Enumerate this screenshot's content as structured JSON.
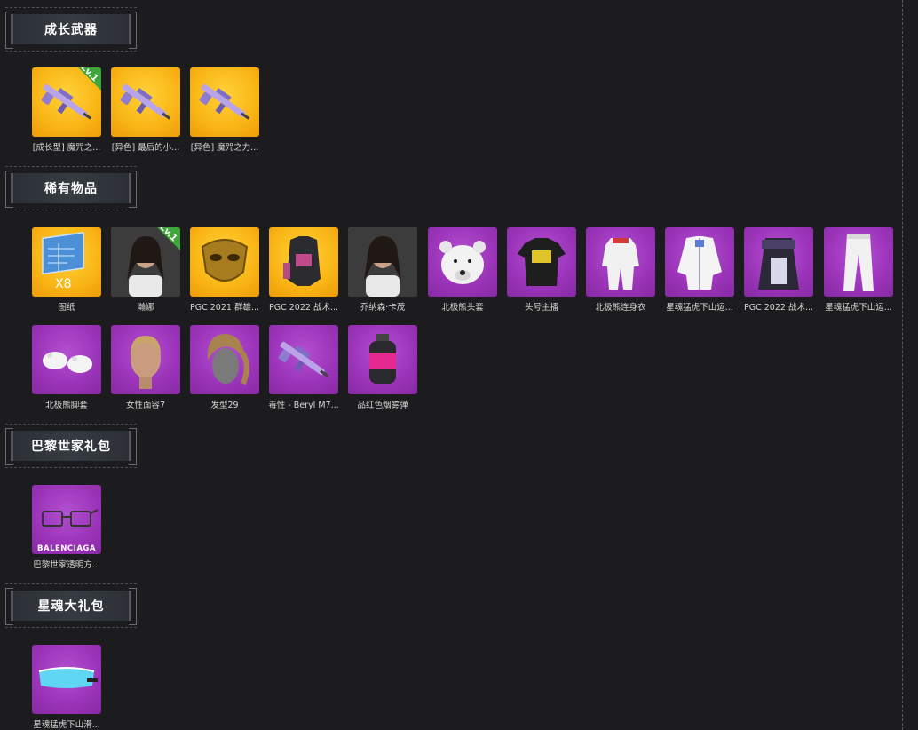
{
  "sections": [
    {
      "title": "成长武器",
      "items": [
        {
          "label": "[成长型] 魔咒之...",
          "rarity": "gold",
          "icon": "rifle-icon",
          "badge": "Lv.1"
        },
        {
          "label": "[异色] 最后的小...",
          "rarity": "gold",
          "icon": "rifle-icon"
        },
        {
          "label": "[异色] 魔咒之力...",
          "rarity": "gold",
          "icon": "rifle-icon"
        }
      ]
    },
    {
      "title": "稀有物品",
      "items": [
        {
          "label": "图纸",
          "rarity": "gold",
          "icon": "blueprint-icon",
          "quantity": "X8"
        },
        {
          "label": "瀚娜",
          "rarity": "gold",
          "icon": "character-icon",
          "badge": "Lv.1"
        },
        {
          "label": "PGC 2021 群雄...",
          "rarity": "gold",
          "icon": "mask-icon"
        },
        {
          "label": "PGC 2022 战术...",
          "rarity": "gold",
          "icon": "vest-icon"
        },
        {
          "label": "乔纳森·卡茂",
          "rarity": "gold",
          "icon": "character-icon"
        },
        {
          "label": "北极熊头套",
          "rarity": "purple",
          "icon": "bear-head-icon"
        },
        {
          "label": "头号主播",
          "rarity": "purple",
          "icon": "tshirt-icon"
        },
        {
          "label": "北极熊连身衣",
          "rarity": "purple",
          "icon": "jumpsuit-icon"
        },
        {
          "label": "星魂猛虎下山运...",
          "rarity": "purple",
          "icon": "jacket-icon"
        },
        {
          "label": "PGC 2022 战术...",
          "rarity": "purple",
          "icon": "coat-icon"
        },
        {
          "label": "星魂猛虎下山运...",
          "rarity": "purple",
          "icon": "pants-icon"
        },
        {
          "label": "北极熊脚套",
          "rarity": "purple",
          "icon": "paws-icon"
        },
        {
          "label": "女性面容7",
          "rarity": "purple",
          "icon": "face-icon"
        },
        {
          "label": "发型29",
          "rarity": "purple",
          "icon": "hair-icon"
        },
        {
          "label": "毒性 - Beryl M7...",
          "rarity": "purple",
          "icon": "rifle-icon"
        },
        {
          "label": "品红色烟雾弹",
          "rarity": "purple",
          "icon": "smoke-grenade-icon"
        }
      ]
    },
    {
      "title": "巴黎世家礼包",
      "items": [
        {
          "label": "巴黎世家透明方...",
          "rarity": "purple",
          "icon": "sunglasses-icon",
          "brand": "BALENCIAGA"
        }
      ]
    },
    {
      "title": "星魂大礼包",
      "items": [
        {
          "label": "星魂猛虎下山滑...",
          "rarity": "purple",
          "icon": "goggles-icon"
        }
      ]
    }
  ],
  "colors": {
    "background": "#1c1c1e",
    "gold": "#f9b515",
    "purple": "#9a33b8",
    "badge": "#3fa639"
  }
}
